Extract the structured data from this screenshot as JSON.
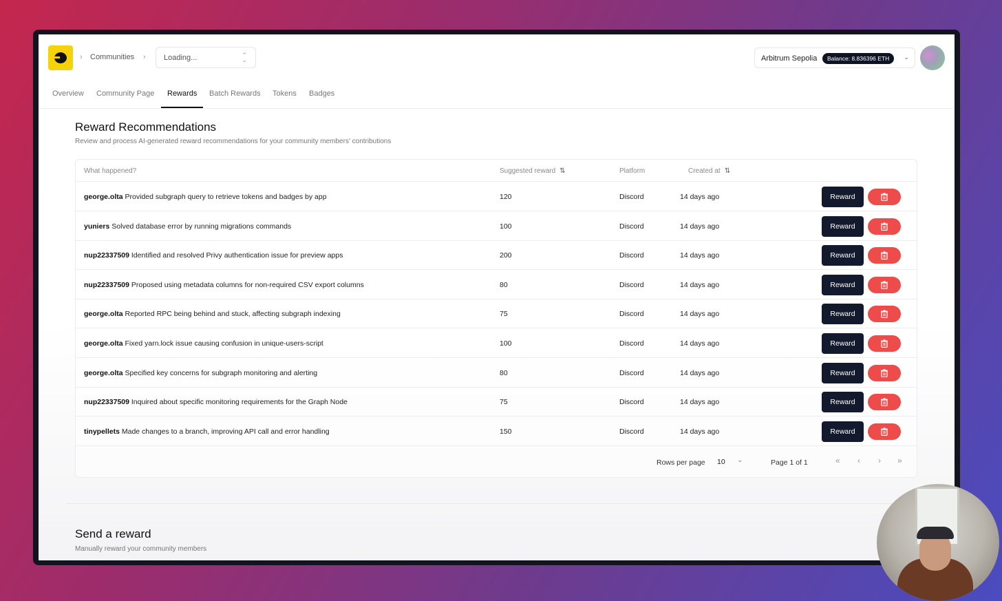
{
  "header": {
    "breadcrumb_communities": "Communities",
    "community_select": "Loading...",
    "network_name": "Arbitrum Sepolia",
    "balance": "Balance: 8.836396 ETH"
  },
  "tabs": [
    {
      "label": "Overview"
    },
    {
      "label": "Community Page"
    },
    {
      "label": "Rewards"
    },
    {
      "label": "Batch Rewards"
    },
    {
      "label": "Tokens"
    },
    {
      "label": "Badges"
    }
  ],
  "active_tab": "Rewards",
  "recommendations": {
    "title": "Reward Recommendations",
    "subtitle": "Review and process AI-generated reward recommendations for your community members' contributions",
    "columns": {
      "what": "What happened?",
      "suggested": "Suggested reward",
      "platform": "Platform",
      "created": "Created at"
    },
    "rows": [
      {
        "user": "george.olta",
        "text": "Provided subgraph query to retrieve tokens and badges by app",
        "reward": "120",
        "platform": "Discord",
        "created": "14 days ago",
        "action": "Reward"
      },
      {
        "user": "yuniers",
        "text": "Solved database error by running migrations commands",
        "reward": "100",
        "platform": "Discord",
        "created": "14 days ago",
        "action": "Reward"
      },
      {
        "user": "nup22337509",
        "text": "Identified and resolved Privy authentication issue for preview apps",
        "reward": "200",
        "platform": "Discord",
        "created": "14 days ago",
        "action": "Reward"
      },
      {
        "user": "nup22337509",
        "text": "Proposed using metadata columns for non-required CSV export columns",
        "reward": "80",
        "platform": "Discord",
        "created": "14 days ago",
        "action": "Reward"
      },
      {
        "user": "george.olta",
        "text": "Reported RPC being behind and stuck, affecting subgraph indexing",
        "reward": "75",
        "platform": "Discord",
        "created": "14 days ago",
        "action": "Reward"
      },
      {
        "user": "george.olta",
        "text": "Fixed yarn.lock issue causing confusion in unique-users-script",
        "reward": "100",
        "platform": "Discord",
        "created": "14 days ago",
        "action": "Reward"
      },
      {
        "user": "george.olta",
        "text": "Specified key concerns for subgraph monitoring and alerting",
        "reward": "80",
        "platform": "Discord",
        "created": "14 days ago",
        "action": "Reward"
      },
      {
        "user": "nup22337509",
        "text": "Inquired about specific monitoring requirements for the Graph Node",
        "reward": "75",
        "platform": "Discord",
        "created": "14 days ago",
        "action": "Reward"
      },
      {
        "user": "tinypellets",
        "text": "Made changes to a branch, improving API call and error handling",
        "reward": "150",
        "platform": "Discord",
        "created": "14 days ago",
        "action": "Reward"
      }
    ],
    "pagination": {
      "rows_per_page_label": "Rows per page",
      "rows_per_page": "10",
      "page_info": "Page 1 of 1",
      "first": "«",
      "prev": "‹",
      "next": "›",
      "last": "»"
    }
  },
  "send_reward": {
    "title": "Send a reward",
    "subtitle": "Manually reward your community members"
  },
  "icons": {
    "sort": "sort-arrows-icon",
    "delete": "trash-icon",
    "chevron": "chevron-right-icon"
  },
  "colors": {
    "reward_button": "#141a2e",
    "delete_button": "#ee4b4b",
    "logo": "#f5d20a"
  }
}
